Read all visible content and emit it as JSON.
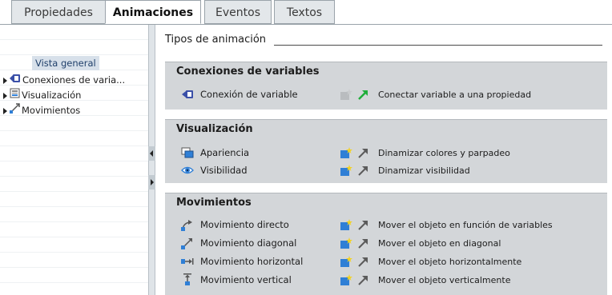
{
  "tabs": [
    {
      "label": "Propiedades",
      "active": false
    },
    {
      "label": "Animaciones",
      "active": true
    },
    {
      "label": "Eventos",
      "active": false
    },
    {
      "label": "Textos",
      "active": false
    }
  ],
  "tree": {
    "header": "Vista general",
    "items": [
      {
        "label": "Conexiones de varia...",
        "icon": "variable-connection-icon"
      },
      {
        "label": "Visualización",
        "icon": "visualization-icon"
      },
      {
        "label": "Movimientos",
        "icon": "movement-icon"
      }
    ]
  },
  "main": {
    "section_title": "Tipos de animación",
    "groups": [
      {
        "title": "Conexiones de variables",
        "rows": [
          {
            "name": "Conexión de variable",
            "icon": "variable-connection-icon",
            "add_enabled": false,
            "arrow_active": true,
            "description": "Conectar variable a una propiedad"
          }
        ]
      },
      {
        "title": "Visualización",
        "rows": [
          {
            "name": "Apariencia",
            "icon": "appearance-icon",
            "add_enabled": true,
            "arrow_active": false,
            "description": "Dinamizar colores y parpadeo"
          },
          {
            "name": "Visibilidad",
            "icon": "visibility-eye-icon",
            "add_enabled": true,
            "arrow_active": false,
            "description": "Dinamizar visibilidad"
          }
        ]
      },
      {
        "title": "Movimientos",
        "rows": [
          {
            "name": "Movimiento directo",
            "icon": "direct-movement-icon",
            "add_enabled": true,
            "arrow_active": false,
            "description": "Mover el objeto en función de variables"
          },
          {
            "name": "Movimiento diagonal",
            "icon": "diagonal-movement-icon",
            "add_enabled": true,
            "arrow_active": false,
            "description": "Mover el objeto en diagonal"
          },
          {
            "name": "Movimiento horizontal",
            "icon": "horizontal-movement-icon",
            "add_enabled": true,
            "arrow_active": false,
            "description": "Mover el objeto horizontalmente"
          },
          {
            "name": "Movimiento vertical",
            "icon": "vertical-movement-icon",
            "add_enabled": true,
            "arrow_active": false,
            "description": "Mover el objeto verticalmente"
          }
        ]
      }
    ]
  },
  "colors": {
    "accent_green": "#1fae3a",
    "inactive_arrow": "#5b5b5b",
    "add_icon_blue": "#2f7fd6",
    "add_icon_star": "#f3d21f",
    "group_background": "#d3d6d9",
    "tree_selected": "#d7e0ea"
  }
}
